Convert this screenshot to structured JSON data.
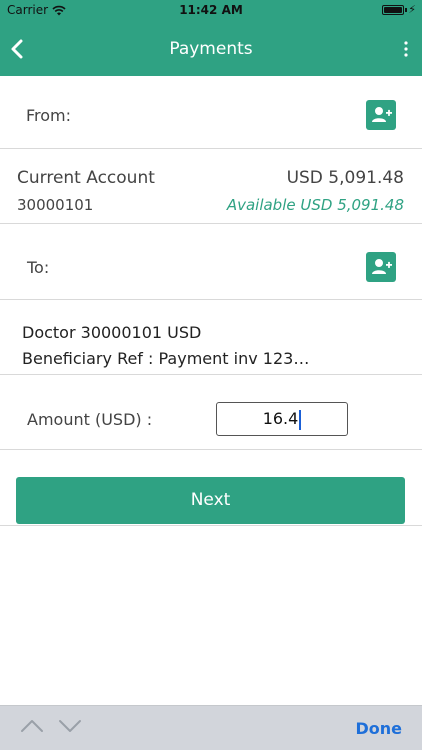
{
  "status_bar": {
    "carrier": "Carrier",
    "time": "11:42 AM",
    "battery_level": 1.0
  },
  "nav": {
    "title": "Payments",
    "back_icon": "chevron-left-icon",
    "more_icon": "vertical-dots-icon"
  },
  "from_section": {
    "label": "From:",
    "contact_icon": "add-contact-icon"
  },
  "source_account": {
    "name": "Current Account",
    "number": "30000101",
    "balance": "USD 5,091.48",
    "available": "Available USD 5,091.48"
  },
  "to_section": {
    "label": "To:",
    "contact_icon": "add-contact-icon"
  },
  "beneficiary": {
    "line1": "Doctor 30000101 USD",
    "line2": "Beneficiary Ref : Payment inv 123…"
  },
  "amount": {
    "label": "Amount (USD) :",
    "value": "16.4"
  },
  "next_button": {
    "label": "Next"
  },
  "keyboard_accessory": {
    "done_label": "Done",
    "prev_icon": "chevron-up-icon",
    "next_icon": "chevron-down-icon"
  },
  "colors": {
    "accent": "#2fa283",
    "link_blue": "#1e6fd9",
    "divider": "#d9d9d9"
  }
}
